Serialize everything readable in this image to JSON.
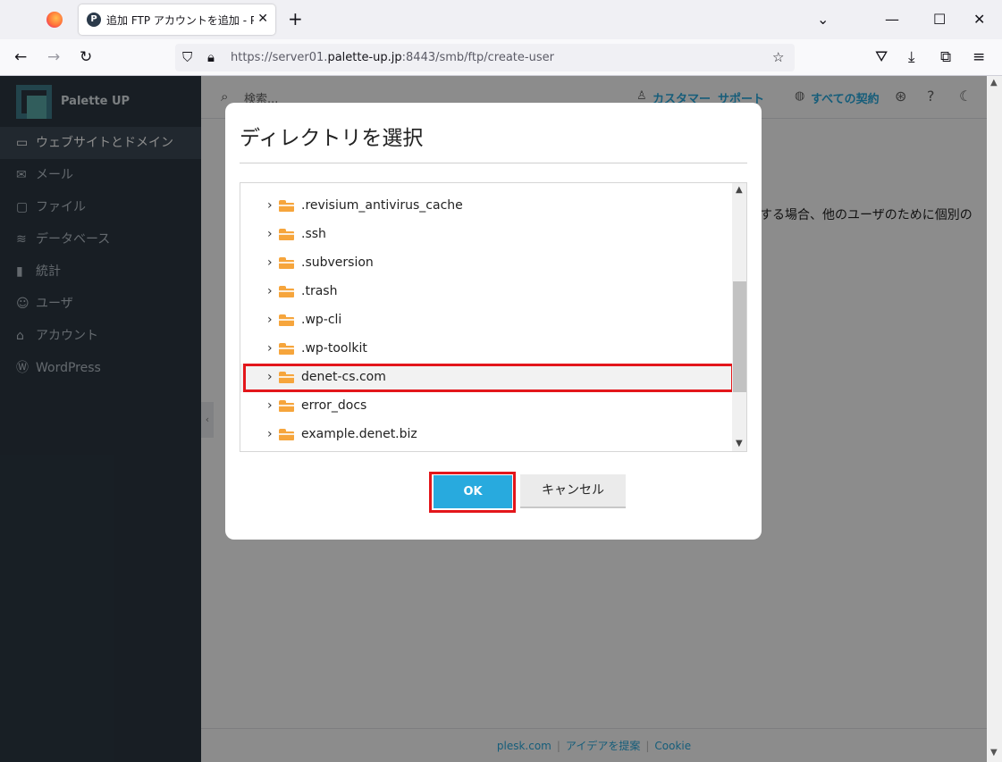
{
  "browser": {
    "tab_title": "追加 FTP アカウントを追加 - Palette",
    "tab_favicon": "P",
    "url_prefix": "https://server01.",
    "url_host": "palette-up.jp",
    "url_rest": ":8443/smb/ftp/create-user"
  },
  "sidebar": {
    "brand": "Palette UP",
    "items": [
      {
        "label": "ウェブサイトとドメイン",
        "icon": "monitor-icon"
      },
      {
        "label": "メール",
        "icon": "mail-icon"
      },
      {
        "label": "ファイル",
        "icon": "folder-icon"
      },
      {
        "label": "データベース",
        "icon": "database-icon"
      },
      {
        "label": "統計",
        "icon": "bar-chart-icon"
      },
      {
        "label": "ユーザ",
        "icon": "user-icon"
      },
      {
        "label": "アカウント",
        "icon": "account-icon"
      },
      {
        "label": "WordPress",
        "icon": "wordpress-icon"
      }
    ]
  },
  "topbar": {
    "search_placeholder": "検索...",
    "customer_link": "カスタマー",
    "support_link": "サポート",
    "subscriptions_link": "すべての契約"
  },
  "main": {
    "body_text": "する場合、他のユーザのために個別の"
  },
  "footer": {
    "links": [
      "plesk.com",
      "アイデアを提案",
      "Cookie"
    ]
  },
  "dialog": {
    "title": "ディレクトリを選択",
    "items": [
      ".revisium_antivirus_cache",
      ".ssh",
      ".subversion",
      ".trash",
      ".wp-cli",
      ".wp-toolkit",
      "denet-cs.com",
      "error_docs",
      "example.denet.biz"
    ],
    "selected_item": "denet-cs.com",
    "ok_label": "OK",
    "cancel_label": "キャンセル"
  },
  "colors": {
    "accent": "#28aade",
    "highlight": "#e3161b",
    "sidebar_bg": "#2c3843",
    "folder": "#f6a53c"
  }
}
